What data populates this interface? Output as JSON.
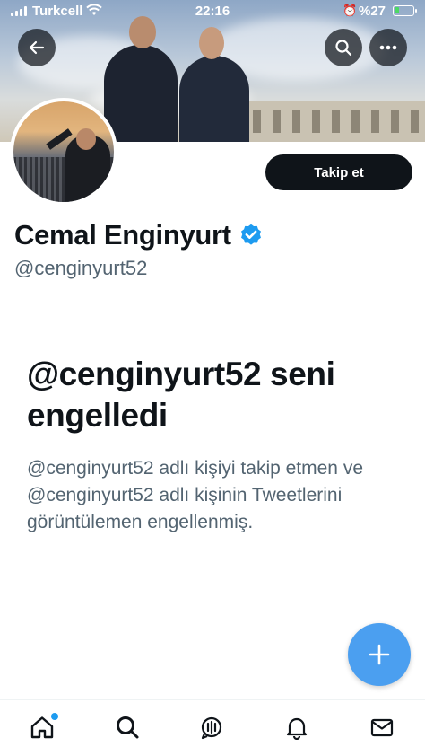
{
  "status_bar": {
    "carrier": "Turkcell",
    "time": "22:16",
    "battery_text": "%27",
    "battery_level": 0.27,
    "icons": [
      "signal-icon",
      "wifi-icon",
      "alarm-icon",
      "battery-charging-icon"
    ]
  },
  "header": {
    "icons": [
      "back-arrow-icon",
      "search-icon",
      "more-icon"
    ]
  },
  "profile": {
    "display_name": "Cemal Enginyurt",
    "handle": "@cenginyurt52",
    "verified": true,
    "follow_label": "Takip et"
  },
  "blocked": {
    "title": "@cenginyurt52 seni engelledi",
    "description": "@cenginyurt52 adlı kişiyi takip etmen ve @cenginyurt52 adlı kişinin Tweetlerini görüntülemen engellenmiş."
  },
  "fab": {
    "icon": "plus-icon"
  },
  "tab_bar": {
    "items": [
      "home-icon",
      "search-icon",
      "spaces-icon",
      "notifications-icon",
      "messages-icon"
    ]
  },
  "colors": {
    "accent": "#1d9bf0",
    "fab": "#4b9ff0",
    "text": "#0f1419",
    "secondary_text": "#536471"
  }
}
